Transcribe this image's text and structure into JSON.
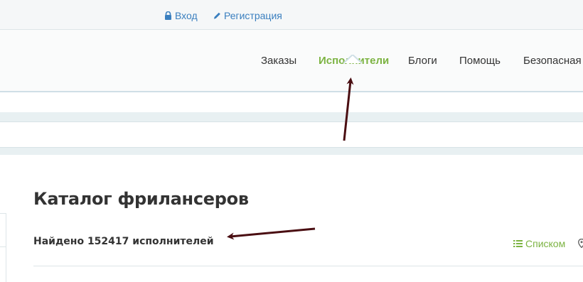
{
  "auth": {
    "login_label": "Вход",
    "register_label": "Регистрация",
    "login_icon": "lock-icon",
    "register_icon": "pencil-icon"
  },
  "nav": {
    "items": [
      {
        "label": "Заказы",
        "active": false
      },
      {
        "label": "Исполнители",
        "active": true
      },
      {
        "label": "Блоги",
        "active": false
      },
      {
        "label": "Помощь",
        "active": false
      },
      {
        "label": "Безопасная",
        "active": false
      }
    ]
  },
  "main": {
    "title": "Каталог фрилансеров",
    "found_text": "Найдено 152417 исполнителей",
    "view_list_label": "Списком",
    "view_list_icon": "list-icon",
    "map_icon": "map-marker-icon"
  },
  "colors": {
    "accent_green": "#7cb342",
    "link_blue": "#3a7fbf",
    "annotation_arrow": "#4a0e12"
  }
}
